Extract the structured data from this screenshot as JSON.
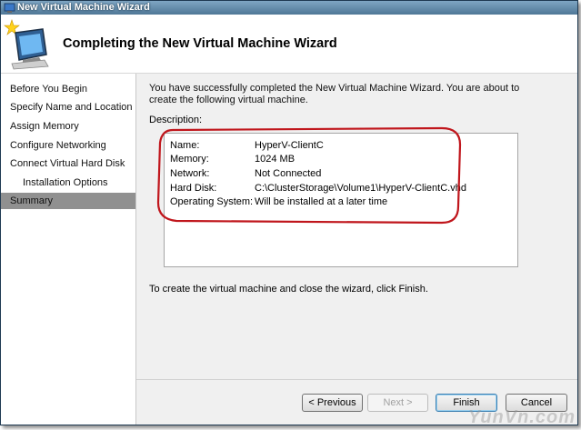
{
  "window": {
    "title": "New Virtual Machine Wizard"
  },
  "header": {
    "title": "Completing the New Virtual Machine Wizard"
  },
  "nav": {
    "items": [
      {
        "label": "Before You Begin"
      },
      {
        "label": "Specify Name and Location"
      },
      {
        "label": "Assign Memory"
      },
      {
        "label": "Configure Networking"
      },
      {
        "label": "Connect Virtual Hard Disk"
      },
      {
        "label": "Installation Options"
      },
      {
        "label": "Summary"
      }
    ],
    "selected": "Summary"
  },
  "content": {
    "intro": "You have successfully completed the New Virtual Machine Wizard. You are about to create the following virtual machine.",
    "description_label": "Description:",
    "description": [
      {
        "key": "Name:",
        "value": "HyperV-ClientC"
      },
      {
        "key": "Memory:",
        "value": "1024 MB"
      },
      {
        "key": "Network:",
        "value": "Not Connected"
      },
      {
        "key": "Hard Disk:",
        "value": "C:\\ClusterStorage\\Volume1\\HyperV-ClientC.vhd"
      },
      {
        "key": "Operating System:",
        "value": "Will be installed at a later time"
      }
    ],
    "finish_text": "To create the virtual machine and close the wizard, click Finish."
  },
  "buttons": {
    "previous": "< Previous",
    "next": "Next >",
    "finish": "Finish",
    "cancel": "Cancel"
  },
  "watermark": "YunVn.com",
  "colors": {
    "highlight": "#c0161c",
    "selected_nav": "#909090",
    "titlebar": "#5f86a6"
  }
}
